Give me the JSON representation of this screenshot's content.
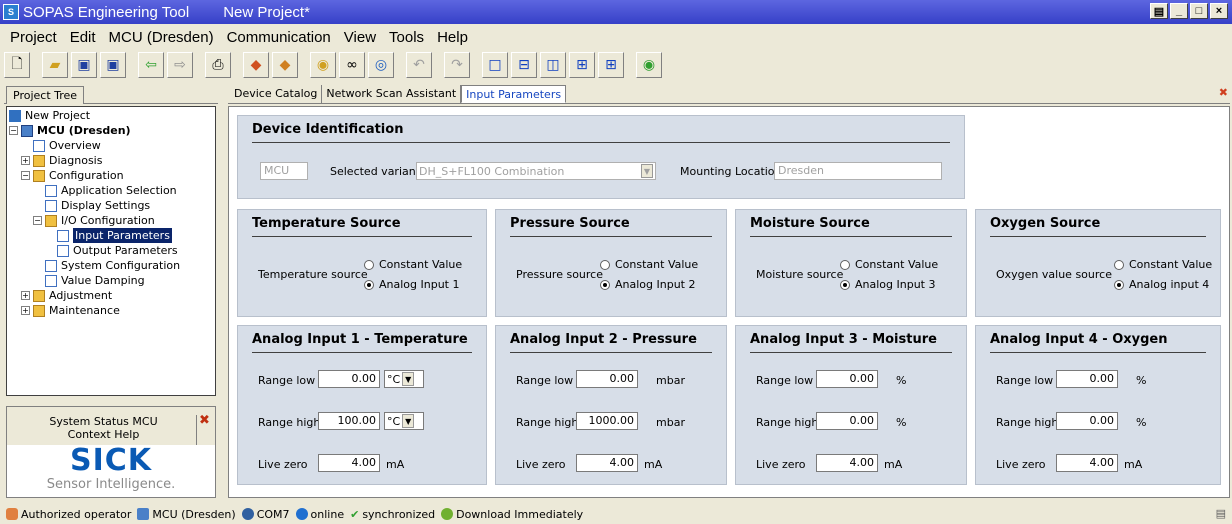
{
  "window": {
    "app_title": "SOPAS Engineering Tool",
    "project_title": "New Project*"
  },
  "menu": [
    "Project",
    "Edit",
    "MCU (Dresden)",
    "Communication",
    "View",
    "Tools",
    "Help"
  ],
  "left": {
    "tab": "Project Tree",
    "tree": [
      {
        "label": "New Project",
        "level": 0,
        "icon": "project-icon",
        "exp": ""
      },
      {
        "label": "MCU (Dresden)",
        "level": 0,
        "icon": "device-icon",
        "exp": "−",
        "bold": true
      },
      {
        "label": "Overview",
        "level": 2,
        "icon": "page-icon",
        "exp": ""
      },
      {
        "label": "Diagnosis",
        "level": 1,
        "icon": "folder-icon",
        "exp": "+"
      },
      {
        "label": "Configuration",
        "level": 1,
        "icon": "folder-icon",
        "exp": "−"
      },
      {
        "label": "Application Selection",
        "level": 3,
        "icon": "page-icon",
        "exp": ""
      },
      {
        "label": "Display Settings",
        "level": 3,
        "icon": "page-icon",
        "exp": ""
      },
      {
        "label": "I/O Configuration",
        "level": 2,
        "icon": "folder-icon",
        "exp": "−"
      },
      {
        "label": "Input Parameters",
        "level": 4,
        "icon": "page-icon",
        "exp": "",
        "selected": true
      },
      {
        "label": "Output Parameters",
        "level": 4,
        "icon": "page-icon",
        "exp": ""
      },
      {
        "label": "System Configuration",
        "level": 3,
        "icon": "page-icon",
        "exp": ""
      },
      {
        "label": "Value Damping",
        "level": 3,
        "icon": "page-icon",
        "exp": ""
      },
      {
        "label": "Adjustment",
        "level": 1,
        "icon": "folder-icon",
        "exp": "+"
      },
      {
        "label": "Maintenance",
        "level": 1,
        "icon": "folder-icon",
        "exp": "+"
      }
    ],
    "status_tab1": "System Status MCU",
    "status_tab2": "Context Help",
    "logo_big": "SICK",
    "logo_small": "Sensor Intelligence."
  },
  "tabs": [
    "Device Catalog",
    "Network Scan Assistant",
    "Input Parameters"
  ],
  "device": {
    "title": "Device Identification",
    "name": "MCU",
    "variant_label": "Selected variant",
    "variant": "DH_S+FL100 Combination",
    "mount_label": "Mounting Location",
    "mount": "Dresden"
  },
  "sources": [
    {
      "title": "Temperature Source",
      "label": "Temperature source",
      "opt1": "Constant Value",
      "opt2": "Analog Input 1"
    },
    {
      "title": "Pressure Source",
      "label": "Pressure source",
      "opt1": "Constant Value",
      "opt2": "Analog Input 2"
    },
    {
      "title": "Moisture Source",
      "label": "Moisture source",
      "opt1": "Constant Value",
      "opt2": "Analog Input 3"
    },
    {
      "title": "Oxygen Source",
      "label": "Oxygen value source",
      "opt1": "Constant Value",
      "opt2": "Analog input 4"
    }
  ],
  "inputs": [
    {
      "title": "Analog Input 1 - Temperature",
      "low_label": "Range low",
      "low": "0.00",
      "high_label": "Range high",
      "high": "100.00",
      "unit": "°C",
      "zero_label": "Live zero",
      "zero": "4.00",
      "zero_unit": "mA"
    },
    {
      "title": "Analog Input 2 - Pressure",
      "low_label": "Range low",
      "low": "0.00",
      "high_label": "Range high",
      "high": "1000.00",
      "unit": "mbar",
      "zero_label": "Live zero",
      "zero": "4.00",
      "zero_unit": "mA"
    },
    {
      "title": "Analog Input 3 - Moisture",
      "low_label": "Range low",
      "low": "0.00",
      "high_label": "Range high",
      "high": "0.00",
      "unit": "%",
      "zero_label": "Live zero",
      "zero": "4.00",
      "zero_unit": "mA"
    },
    {
      "title": "Analog Input 4 - Oxygen",
      "low_label": "Range low",
      "low": "0.00",
      "high_label": "Range high",
      "high": "0.00",
      "unit": "%",
      "zero_label": "Live zero",
      "zero": "4.00",
      "zero_unit": "mA"
    }
  ],
  "status": {
    "user": "Authorized operator",
    "device": "MCU (Dresden)",
    "port": "COM7",
    "online": "online",
    "sync": "synchronized",
    "download": "Download Immediately"
  }
}
